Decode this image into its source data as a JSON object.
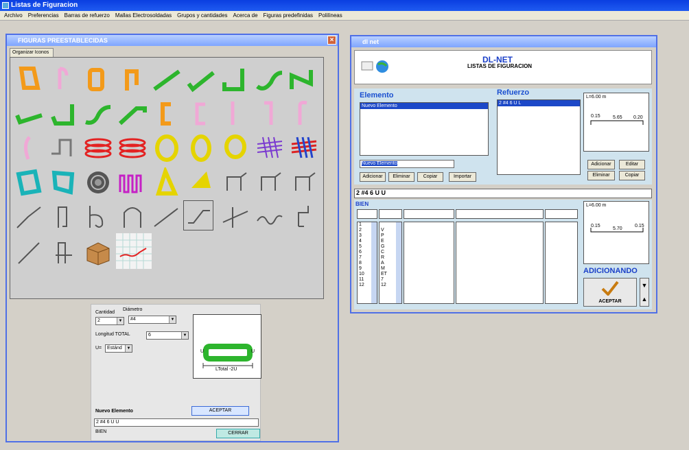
{
  "app": {
    "title": "Listas de Figuracion"
  },
  "menu": [
    "Archivo",
    "Preferencias",
    "Barras de refuerzo",
    "Mallas Electrosoldadas",
    "Grupos y cantidades",
    "Acerca de",
    "Figuras predefinidas",
    "Polilíneas"
  ],
  "figuras": {
    "title": "FIGURAS PREESTABLECIDAS",
    "tab": "Organizar Iconos",
    "cantidad_label": "Cantidad",
    "cantidad_value": "2",
    "diametro_label": "Diámetro",
    "diametro_value": "#4",
    "longitud_label": "Longitud TOTAL",
    "longitud_value": "6",
    "u_label": "U=",
    "u_value": "Estánd",
    "diagram_label": "LTotal -2U",
    "diagram_u_left": "U",
    "diagram_u_right": "U",
    "nuevo_label": "Nuevo Elemento",
    "aceptar": "ACEPTAR",
    "nuevo_value": "2 #4 6 U U",
    "status": "BIEN",
    "cerrar": "CERRAR"
  },
  "dlnet": {
    "title": "dl net",
    "brand": "DL-NET",
    "subtitle": "LISTAS DE FIGURACION",
    "elemento": "Elemento",
    "elemento_item": "Nuevo Elemento",
    "elemento_input": "Nuevo Elemento",
    "refuerzo": "Refuerzo",
    "refuerzo_item": "2 #4 6 U L",
    "btn_adicionar": "Adicionar",
    "btn_eliminar": "Eliminar",
    "btn_copiar": "Copiar",
    "btn_importar": "Importar",
    "btn_editar": "Editar",
    "preview_top": {
      "length": "L=6.00 m",
      "left": "0.15",
      "mid": "5.65",
      "right": "0.20"
    },
    "preview_bottom": {
      "length": "L=6.00 m",
      "left": "0.15",
      "mid": "5.70",
      "right": "0.15"
    },
    "descriptor": "2 #4 6 U U",
    "status": "BIEN",
    "rows": [
      "1",
      "2",
      "3",
      "4",
      "5",
      "6",
      "7",
      "8",
      "9",
      "10",
      "11",
      "12"
    ],
    "letters": [
      "V",
      "P",
      "E",
      "G",
      "C",
      "R",
      "A",
      "M",
      "ET",
      "7",
      "12"
    ],
    "adicionando": "ADICIONANDO",
    "aceptar": "ACEPTAR"
  }
}
